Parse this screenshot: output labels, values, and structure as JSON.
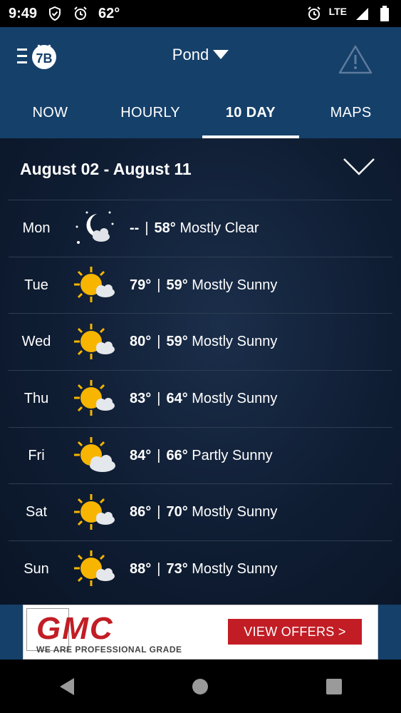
{
  "status_bar": {
    "time": "9:49",
    "temperature": "62°",
    "network": "LTE",
    "icons": [
      "shield-icon",
      "alarm-icon",
      "alarm-icon",
      "signal-icon",
      "battery-icon"
    ]
  },
  "header": {
    "location": "Pond",
    "icons": [
      "menu-icon",
      "app-logo-icon",
      "dropdown-arrow-icon",
      "alert-triangle-icon"
    ]
  },
  "tabs": [
    {
      "label": "NOW",
      "active": false
    },
    {
      "label": "HOURLY",
      "active": false
    },
    {
      "label": "10 DAY",
      "active": true
    },
    {
      "label": "MAPS",
      "active": false
    }
  ],
  "range": {
    "title": "August 02 - August 11"
  },
  "days": [
    {
      "day": "Mon",
      "high": "--",
      "low": "58°",
      "condition": "Mostly Clear",
      "icon": "moon-cloud-icon"
    },
    {
      "day": "Tue",
      "high": "79°",
      "low": "59°",
      "condition": "Mostly Sunny",
      "icon": "sun-cloud-icon"
    },
    {
      "day": "Wed",
      "high": "80°",
      "low": "59°",
      "condition": "Mostly Sunny",
      "icon": "sun-cloud-icon"
    },
    {
      "day": "Thu",
      "high": "83°",
      "low": "64°",
      "condition": "Mostly Sunny",
      "icon": "sun-cloud-icon"
    },
    {
      "day": "Fri",
      "high": "84°",
      "low": "66°",
      "condition": "Partly Sunny",
      "icon": "sun-cloud-icon"
    },
    {
      "day": "Sat",
      "high": "86°",
      "low": "70°",
      "condition": "Mostly Sunny",
      "icon": "sun-cloud-icon"
    },
    {
      "day": "Sun",
      "high": "88°",
      "low": "73°",
      "condition": "Mostly Sunny",
      "icon": "sun-cloud-icon"
    }
  ],
  "ad": {
    "brand": "GMC",
    "tagline": "WE ARE PROFESSIONAL GRADE",
    "cta": "VIEW OFFERS >"
  },
  "colors": {
    "header_bg": "#15406a",
    "ad_red": "#c21d25",
    "sun": "#f7b500"
  }
}
